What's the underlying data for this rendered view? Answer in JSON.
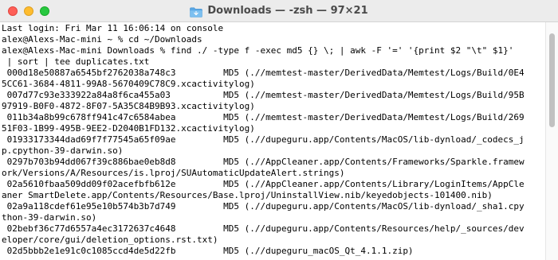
{
  "window": {
    "title": "Downloads — -zsh — 97×21",
    "folder_icon": "folder-icon"
  },
  "terminal": {
    "lines": [
      "Last login: Fri Mar 11 16:06:14 on console",
      "alex@Alexs-Mac-mini ~ % cd ~/Downloads",
      "alex@Alexs-Mac-mini Downloads % find ./ -type f -exec md5 {} \\; | awk -F '=' '{print $2 \"\\t\" $1}'",
      " | sort | tee duplicates.txt",
      " 000d18e50887a6545bf2762038a748c3         MD5 (.//memtest-master/DerivedData/Memtest/Logs/Build/0E4",
      "5CC61-3684-4811-99A8-5670409C78C9.xcactivitylog)",
      " 007d77c93e333922a84a8f6ca455a03          MD5 (.//memtest-master/DerivedData/Memtest/Logs/Build/95B",
      "97919-B0F0-4872-8F07-5A35C84B9B93.xcactivitylog)",
      " 011b34a8b99c678ff941c47c6584abea         MD5 (.//memtest-master/DerivedData/Memtest/Logs/Build/269",
      "51F03-1B99-495B-9EE2-D2040B1FD132.xcactivitylog)",
      " 01933173344dad69f7f77545a65f09ae         MD5 (.//dupeguru.app/Contents/MacOS/lib-dynload/_codecs_j",
      "p.cpython-39-darwin.so)",
      " 0297b703b94dd067f39c886bae0eb8d8         MD5 (.//AppCleaner.app/Contents/Frameworks/Sparkle.framew",
      "ork/Versions/A/Resources/is.lproj/SUAutomaticUpdateAlert.strings)",
      " 02a5610fbaa509dd09f02acefbfb612e         MD5 (.//AppCleaner.app/Contents/Library/LoginItems/AppCle",
      "aner SmartDelete.app/Contents/Resources/Base.lproj/UninstallView.nib/keyedobjects-101400.nib)",
      " 02a9a118cdef61e95e10b574b3b7d749         MD5 (.//dupeguru.app/Contents/MacOS/lib-dynload/_sha1.cpy",
      "thon-39-darwin.so)",
      " 02bebf36c77d6557a4ec3172637c4648         MD5 (.//dupeguru.app/Contents/Resources/help/_sources/dev",
      "eloper/core/gui/deletion_options.rst.txt)",
      " 02d5bbb2e1e91c0c1085ccd4de5d22fb         MD5 (.//dupeguru_macOS_Qt_4.1.1.zip)"
    ]
  }
}
